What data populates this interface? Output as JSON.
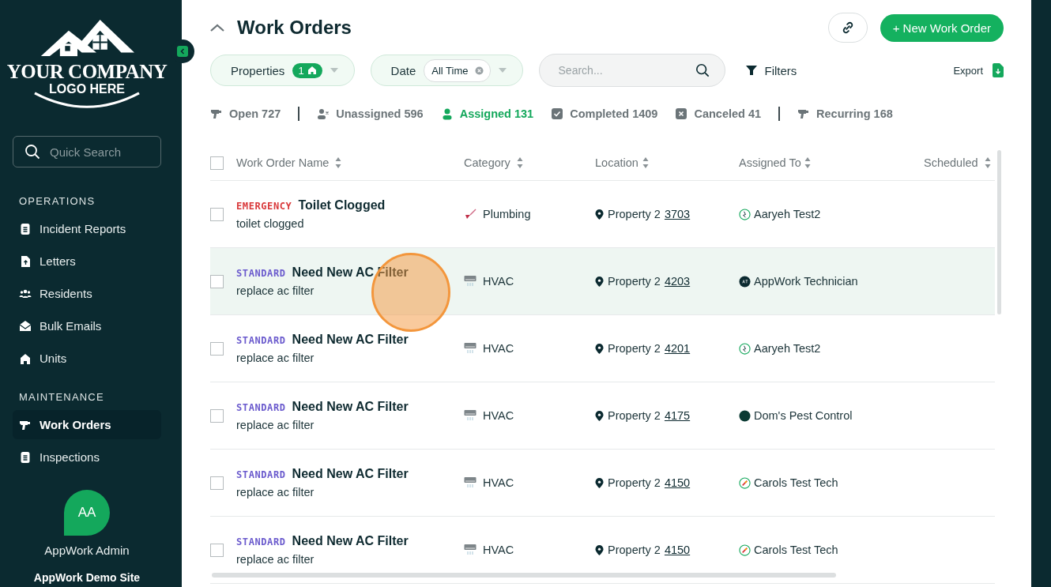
{
  "logo": {
    "line_1": "YOUR COMPANY",
    "line_2": "LOGO HERE"
  },
  "sidebar": {
    "search": {
      "placeholder": "Quick Search"
    },
    "sections": [
      {
        "title": "OPERATIONS",
        "items": [
          {
            "label": "Incident Reports",
            "kind": "document",
            "selected": false
          },
          {
            "label": "Letters",
            "kind": "upload",
            "selected": false
          },
          {
            "label": "Residents",
            "kind": "people",
            "selected": false
          },
          {
            "label": "Bulk Emails",
            "kind": "envelope",
            "selected": false
          },
          {
            "label": "Units",
            "kind": "house",
            "selected": false
          }
        ]
      },
      {
        "title": "MAINTENANCE",
        "items": [
          {
            "label": "Work Orders",
            "kind": "tool",
            "selected": true
          },
          {
            "label": "Inspections",
            "kind": "document",
            "selected": false
          }
        ]
      }
    ],
    "user": {
      "initials": "AA",
      "name": "AppWork Admin",
      "site": "AppWork Demo Site"
    }
  },
  "header": {
    "title": "Work Orders",
    "new_button": "+ New Work Order"
  },
  "filters": {
    "properties": {
      "label": "Properties",
      "count": "1"
    },
    "date": {
      "label": "Date",
      "value": "All Time"
    },
    "search": {
      "placeholder": "Search..."
    },
    "filters_button": "Filters",
    "export_button": "Export"
  },
  "status_tabs": [
    {
      "label": "Open 727",
      "kind": "tool",
      "selected": false,
      "divider_after": true
    },
    {
      "label": "Unassigned 596",
      "kind": "unassigned",
      "selected": false,
      "divider_after": false
    },
    {
      "label": "Assigned 131",
      "kind": "assigned",
      "selected": true,
      "divider_after": false
    },
    {
      "label": "Completed 1409",
      "kind": "completed",
      "selected": false,
      "divider_after": false
    },
    {
      "label": "Canceled 41",
      "kind": "canceled",
      "selected": false,
      "divider_after": true
    },
    {
      "label": "Recurring 168",
      "kind": "tool",
      "selected": false,
      "divider_after": false
    }
  ],
  "table": {
    "select_all": {
      "checked": false
    },
    "columns": [
      "Work Order Name",
      "Category",
      "Location",
      "Assigned To",
      "Scheduled"
    ],
    "rows": [
      {
        "checked": false,
        "selected": false,
        "priority": {
          "label": "EMERGENCY",
          "color": "#d9383a"
        },
        "title": "Toilet Clogged",
        "description": "toilet clogged",
        "category": {
          "label": "Plumbing",
          "kind": "plumbing"
        },
        "property": "Property 2",
        "unit": "3703",
        "assignee": {
          "name": "Aaryeh Test2",
          "kind": "badge"
        }
      },
      {
        "checked": false,
        "selected": true,
        "priority": {
          "label": "STANDARD",
          "color": "#6a5acd"
        },
        "title": "Need New AC Filter",
        "description": "replace ac filter",
        "category": {
          "label": "HVAC",
          "kind": "hvac"
        },
        "property": "Property 2",
        "unit": "4203",
        "assignee": {
          "name": "AppWork Technician",
          "kind": "initials"
        }
      },
      {
        "checked": false,
        "selected": false,
        "priority": {
          "label": "STANDARD",
          "color": "#6a5acd"
        },
        "title": "Need New AC Filter",
        "description": "replace ac filter",
        "category": {
          "label": "HVAC",
          "kind": "hvac"
        },
        "property": "Property 2",
        "unit": "4201",
        "assignee": {
          "name": "Aaryeh Test2",
          "kind": "badge"
        }
      },
      {
        "checked": false,
        "selected": false,
        "priority": {
          "label": "STANDARD",
          "color": "#6a5acd"
        },
        "title": "Need New AC Filter",
        "description": "replace ac filter",
        "category": {
          "label": "HVAC",
          "kind": "hvac"
        },
        "property": "Property 2",
        "unit": "4175",
        "assignee": {
          "name": "Dom's Pest Control",
          "kind": "dot"
        }
      },
      {
        "checked": false,
        "selected": false,
        "priority": {
          "label": "STANDARD",
          "color": "#6a5acd"
        },
        "title": "Need New AC Filter",
        "description": "replace ac filter",
        "category": {
          "label": "HVAC",
          "kind": "hvac"
        },
        "property": "Property 2",
        "unit": "4150",
        "assignee": {
          "name": "Carols Test Tech",
          "kind": "rocket"
        }
      },
      {
        "checked": false,
        "selected": false,
        "priority": {
          "label": "STANDARD",
          "color": "#6a5acd"
        },
        "title": "Need New AC Filter",
        "description": "replace ac filter",
        "category": {
          "label": "HVAC",
          "kind": "hvac"
        },
        "property": "Property 2",
        "unit": "4150",
        "assignee": {
          "name": "Carols Test Tech",
          "kind": "rocket"
        }
      }
    ]
  }
}
